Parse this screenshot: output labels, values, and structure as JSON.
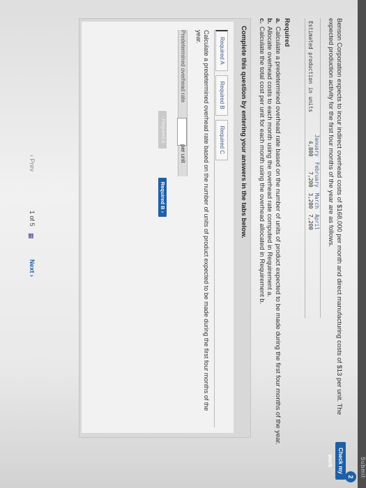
{
  "header": {
    "top_text": "Submit",
    "question_number": "2",
    "check_label": "Check my work"
  },
  "intro": "Benson Corporation expects to incur indirect overhead costs of $168,000 per month and direct manufacturing costs of $13 per unit. The expected production activity for the first four months of the year are as follows.",
  "production_table": {
    "months": [
      "January",
      "February",
      "March",
      "April"
    ],
    "row_label": "Estimated production in units",
    "values": [
      "4,800",
      "7,200",
      "3,200",
      "7,200"
    ]
  },
  "required": {
    "heading": "Required",
    "items": [
      {
        "letter": "a.",
        "text": "Calculate a predetermined overhead rate based on the number of units of product expected to be made during the first four months of the year."
      },
      {
        "letter": "b.",
        "text": "Allocate overhead costs to each month using the overhead rate computed in Requirement a."
      },
      {
        "letter": "c.",
        "text": "Calculate the total cost per unit for each month using the overhead allocated in Requirement b."
      }
    ]
  },
  "panel": {
    "title": "Complete this question by entering your answers in the tabs below.",
    "tabs": [
      "Required A",
      "Required B",
      "Required C"
    ],
    "task": "Calculate a predetermined overhead rate based on the number of units of product expected to be made during the first four months of the year.",
    "rate_label": "Predetermined overhead rate",
    "rate_value": "",
    "rate_unit": "per unit",
    "prev_label": "‹ Required A",
    "next_label": "Required B  ›"
  },
  "pager": {
    "prev": "‹  Prev",
    "current": "1",
    "of": "of",
    "total": "5",
    "next": "Next  ›"
  }
}
